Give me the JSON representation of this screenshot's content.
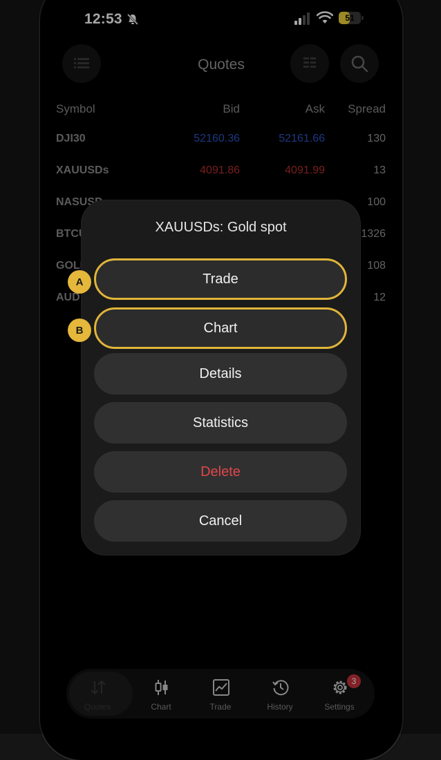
{
  "status": {
    "time": "12:53",
    "battery": "51",
    "battery_level": 0.51
  },
  "header": {
    "title": "Quotes"
  },
  "table": {
    "columns": [
      "Symbol",
      "Bid",
      "Ask",
      "Spread"
    ],
    "rows": [
      {
        "symbol": "DJI30",
        "bid": "52160.36",
        "ask": "52161.66",
        "spread": "130",
        "color": "#2f56c8"
      },
      {
        "symbol": "XAUUSDs",
        "bid": "4091.86",
        "ask": "4091.99",
        "spread": "13",
        "color": "#b8302f"
      },
      {
        "symbol": "NASUSD",
        "bid": "",
        "ask": "",
        "spread": "100",
        "color": "#2f56c8"
      },
      {
        "symbol": "BTCU",
        "bid": "",
        "ask": "",
        "spread": "1326",
        "color": "#b8302f"
      },
      {
        "symbol": "GOLD",
        "bid": "",
        "ask": "",
        "spread": "108",
        "color": "#2f56c8"
      },
      {
        "symbol": "AUD",
        "bid": "",
        "ask": "",
        "spread": "12",
        "color": "#2f56c8"
      }
    ]
  },
  "sheet": {
    "title": "XAUUSDs: Gold spot",
    "actions": [
      "Trade",
      "Chart",
      "Details",
      "Statistics",
      "Delete",
      "Cancel"
    ],
    "markers": [
      "A",
      "B"
    ]
  },
  "nav": {
    "items": [
      "Quotes",
      "Chart",
      "Trade",
      "History",
      "Settings"
    ],
    "settings_badge": "3"
  },
  "colors": {
    "accent": "#e0b53a",
    "danger": "#e0474b",
    "bid_blue": "#2f56c8",
    "ask_red": "#b8302f"
  }
}
